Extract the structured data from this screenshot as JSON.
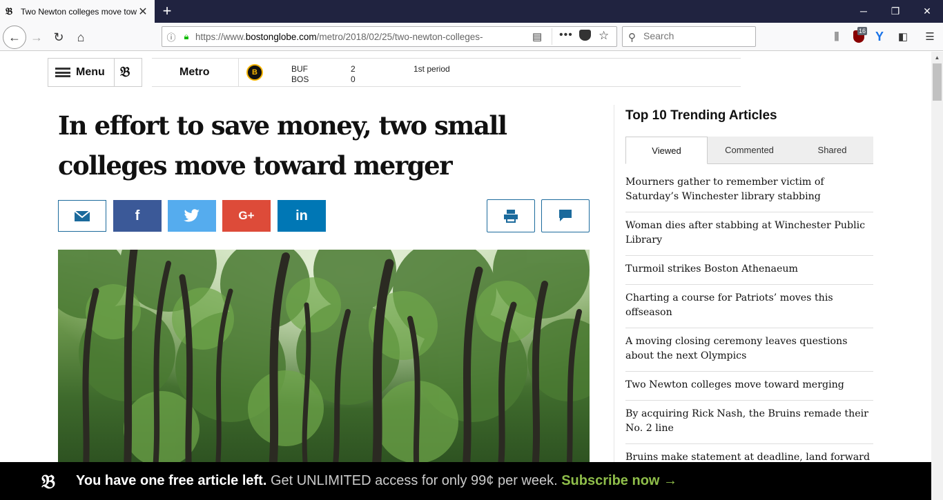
{
  "browser": {
    "tab_title": "Two Newton colleges move tow",
    "tab_favicon": "𝔅",
    "url_prefix": "https://www.",
    "url_domain": "bostonglobe.com",
    "url_path": "/metro/2018/02/25/two-newton-colleges-",
    "search_placeholder": "Search",
    "ublock_badge": "16"
  },
  "header": {
    "menu_label": "Menu",
    "logo": "𝔅",
    "section": "Metro"
  },
  "score": {
    "team1": "BUF",
    "team2": "BOS",
    "score1": "2",
    "score2": "0",
    "period": "1st period"
  },
  "article": {
    "headline": "In effort to save money, two small colleges move toward merger"
  },
  "sidebar": {
    "title": "Top 10 Trending Articles",
    "tabs": [
      {
        "label": "Viewed"
      },
      {
        "label": "Commented"
      },
      {
        "label": "Shared"
      }
    ],
    "items": [
      {
        "label": "Mourners gather to remember victim of Saturday’s Winchester library stabbing"
      },
      {
        "label": "Woman dies after stabbing at Winchester Public Library"
      },
      {
        "label": "Turmoil strikes Boston Athenaeum"
      },
      {
        "label": "Charting a course for Patriots’ moves this offseason"
      },
      {
        "label": "A moving closing ceremony leaves questions about the next Olympics"
      },
      {
        "label": "Two Newton colleges move toward merging"
      },
      {
        "label": "By acquiring Rick Nash, the Bruins remade their No. 2 line"
      },
      {
        "label": "Bruins make statement at deadline, land forward Rick Nash"
      }
    ]
  },
  "paywall": {
    "logo": "𝔅",
    "strong": "You have one free article left.",
    "offer": " Get UNLIMITED access for only 99¢ per week. ",
    "cta": "Subscribe now →"
  }
}
